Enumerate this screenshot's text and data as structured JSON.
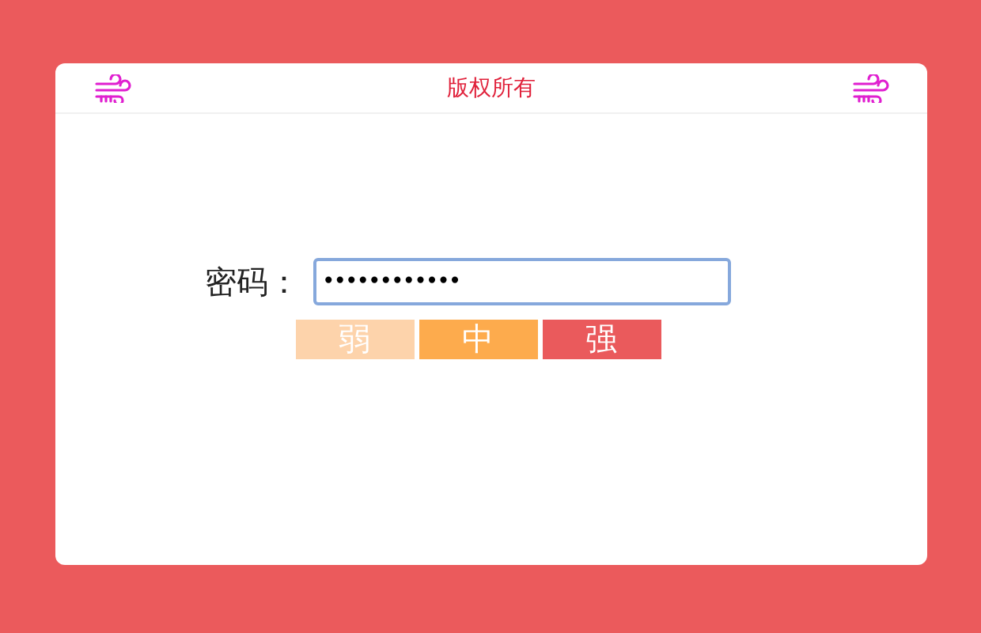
{
  "header": {
    "title": "版权所有"
  },
  "form": {
    "label": "密码：",
    "value": "••••••••••••"
  },
  "strength": [
    {
      "label": "弱",
      "color": "#fdd3ab",
      "on": true
    },
    {
      "label": "中",
      "color": "#fdab4d",
      "on": true
    },
    {
      "label": "强",
      "color": "#ea5a5c",
      "on": true
    }
  ]
}
